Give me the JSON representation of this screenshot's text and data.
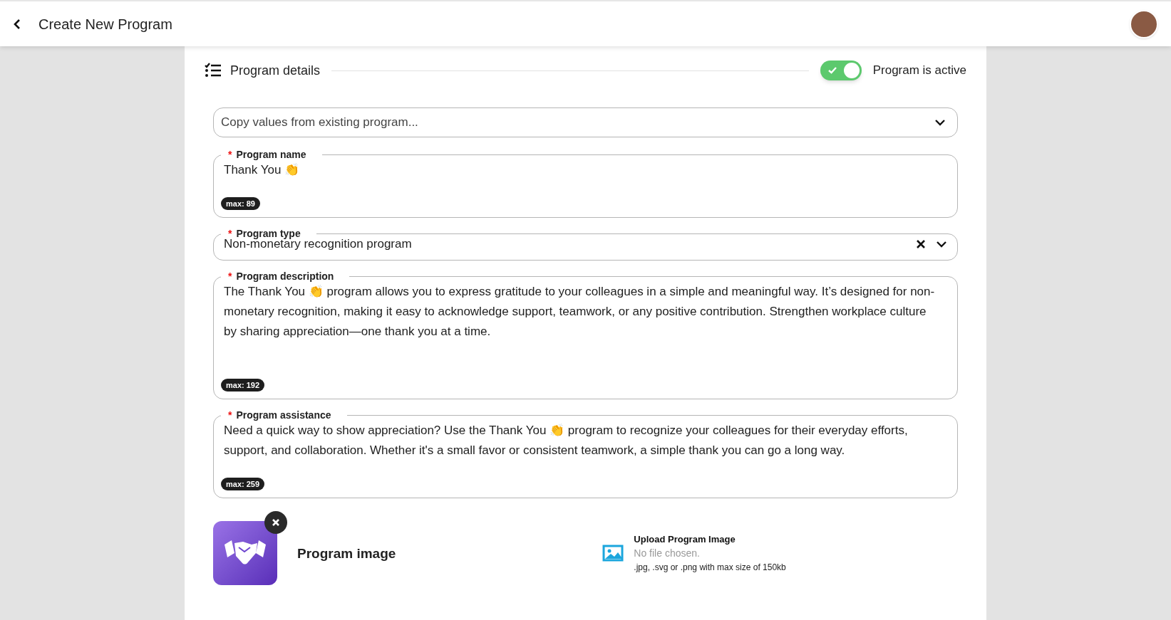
{
  "header": {
    "title": "Create New Program"
  },
  "section": {
    "title": "Program details",
    "active_toggle": {
      "on": true,
      "label": "Program is active"
    }
  },
  "copy_select": {
    "placeholder": "Copy values from existing program..."
  },
  "fields": [
    {
      "kind": "text",
      "label": "Program name",
      "required_mark": "*",
      "value": "Thank You 👏",
      "max": "max: 89"
    },
    {
      "kind": "select",
      "label": "Program type",
      "required_mark": "*",
      "value": "Non-monetary recognition program"
    },
    {
      "kind": "textarea",
      "label": "Program description",
      "required_mark": "*",
      "value": "The Thank You 👏 program allows you to express gratitude to your colleagues in a simple and meaningful way. It’s designed for non-monetary recognition, making it easy to acknowledge support, teamwork, or any positive contribution. Strengthen workplace culture by sharing appreciation—one thank you at a time.",
      "max": "max: 192"
    },
    {
      "kind": "textarea_short",
      "label": "Program assistance",
      "required_mark": "*",
      "value": "Need a quick way to show appreciation? Use the Thank You 👏 program to recognize your colleagues for their everyday efforts, support, and collaboration. Whether it's a small favor or consistent teamwork, a simple thank you can go a long way.",
      "max": "max: 259"
    }
  ],
  "image": {
    "label": "Program image",
    "upload_title": "Upload Program Image",
    "file_status": "No file chosen.",
    "hint": ".jpg, .svg or .png with max size of 150kb"
  }
}
